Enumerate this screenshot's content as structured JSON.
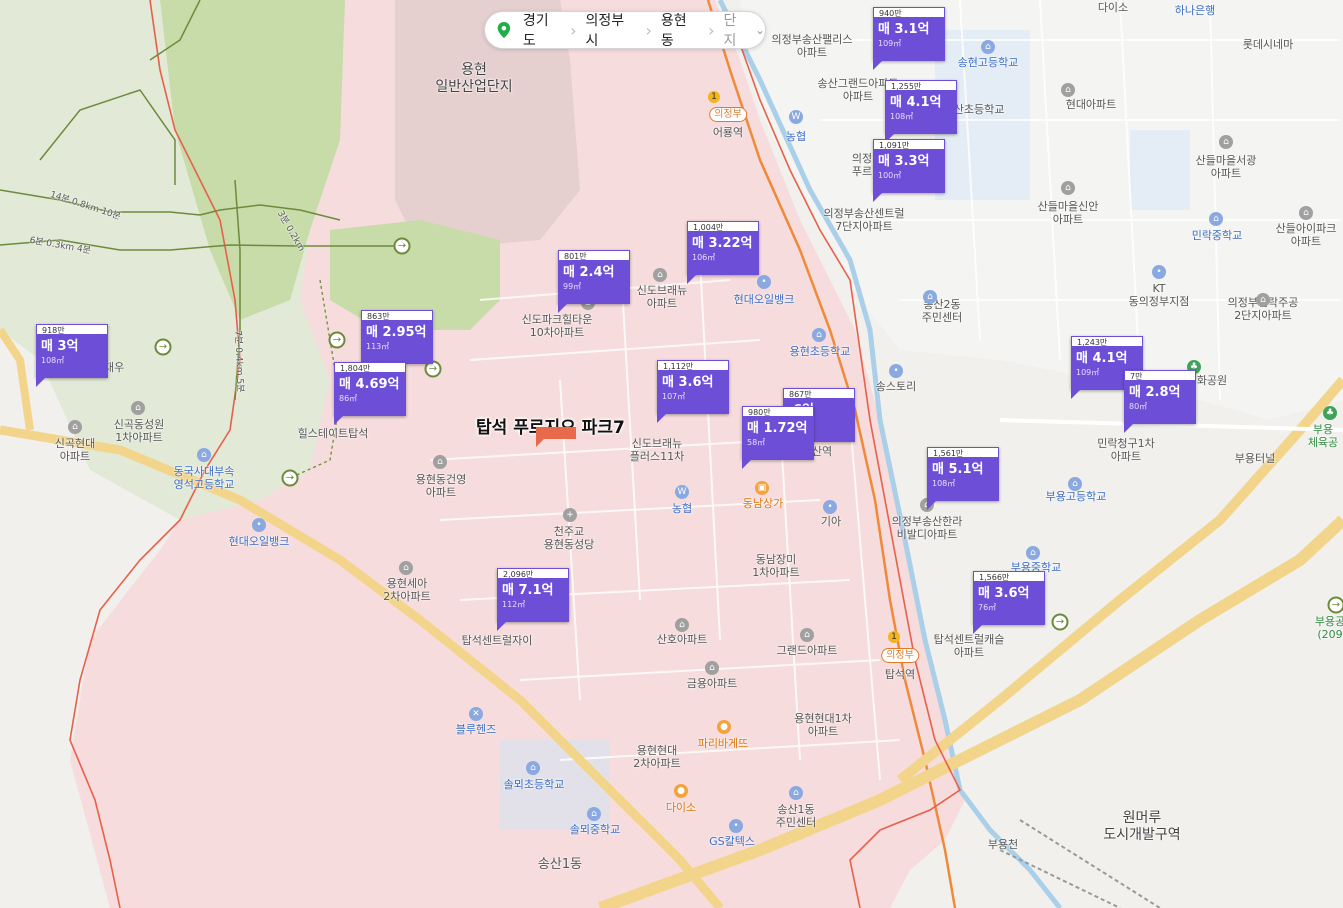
{
  "breadcrumb": {
    "items": [
      "경기도",
      "의정부시",
      "용현동"
    ],
    "dropdown": "단지"
  },
  "selected_complex": "탑석 푸르지오 파크7",
  "listings": [
    {
      "ppa": "940만",
      "price": "매 3.1억",
      "area": "109㎡"
    },
    {
      "ppa": "1,255만",
      "price": "매 4.1억",
      "area": "108㎡"
    },
    {
      "ppa": "1,091만",
      "price": "매 3.3억",
      "area": "100㎡"
    },
    {
      "ppa": "1,004만",
      "price": "매 3.22억",
      "area": "106㎡"
    },
    {
      "ppa": "801만",
      "price": "매 2.4억",
      "area": "99㎡"
    },
    {
      "ppa": "863만",
      "price": "매 2.95억",
      "area": "113㎡"
    },
    {
      "ppa": "918만",
      "price": "매 3억",
      "area": "108㎡"
    },
    {
      "ppa": "1,804만",
      "price": "매 4.69억",
      "area": "86㎡"
    },
    {
      "ppa": "1,112만",
      "price": "매 3.6억",
      "area": "107㎡"
    },
    {
      "ppa": "867만",
      "price": ".6억",
      "area": ""
    },
    {
      "ppa": "980만",
      "price": "매 1.72억",
      "area": "58㎡"
    },
    {
      "ppa": "1,243만",
      "price": "매 4.1억",
      "area": "109㎡"
    },
    {
      "ppa": "7만",
      "price": "매 2.8억",
      "area": "80㎡"
    },
    {
      "ppa": "1,561만",
      "price": "매 5.1억",
      "area": "108㎡"
    },
    {
      "ppa": "2,096만",
      "price": "매 7.1억",
      "area": "112㎡"
    },
    {
      "ppa": "1,566만",
      "price": "매 3.6억",
      "area": "76㎡"
    }
  ],
  "labels": {
    "l0": "용현\n일반산업단지",
    "l1": "의정부송산팰리스\n아파트",
    "l2": "송산그랜드아파트\n아파트",
    "l3": "송산초등학교",
    "l4": "의정\n푸르",
    "l5": "의정부송산센트럴\n7단지아파트",
    "l6": "송현고등학교",
    "l7": "현대아파트",
    "l8": "산들마을서광\n아파트",
    "l9": "산들마을신안\n아파트",
    "l10": "민락중학교",
    "l11": "산들아이파크\n아파트",
    "l12": "다이소",
    "l13": "하나은행",
    "l14": "롯데시네마",
    "l15": "어룡역",
    "l16": "농협",
    "l17": "KT\n동의정부지점",
    "l18": "의정부민락주공\n2단지아파트",
    "l19": "송산2동\n주민센터",
    "l20": "신도브래뉴\n아파트",
    "l21": "현대오일뱅크",
    "l22": "신도파크힐타운\n10차아파트",
    "l23": "용현초등학교",
    "l24": "송스토리",
    "l25": "신도브래뉴\n플러스11차",
    "l26": "송산역",
    "l27": "민락청구1차\n아파트",
    "l28": "화공원",
    "l29": "부용고등학교",
    "l30": "신곡동성원\n1차아파트",
    "l31": "신곡대우",
    "l32": "신곡현대\n아파트",
    "l33": "힐스테이트탑석",
    "l34": "용현동건영\n아파트",
    "l35": "동국사대부속\n영석고등학교",
    "l36": "현대오일뱅크",
    "l37": "천주교\n용현동성당",
    "l38": "농협",
    "l39": "동남상가",
    "l40": "기아",
    "l41": "의정부송산한라\n비발디아파트",
    "l42": "부용중학교",
    "l43": "부용터널",
    "l44": "부용\n체육공",
    "l45": "동남장미\n1차아파트",
    "l46": "용현세아\n2차아파트",
    "l47": "탑석센트럴자이",
    "l48": "산호아파트",
    "l49": "그랜드아파트",
    "l50": "탑석센트럴캐슬\n아파트",
    "l51": "탑석역",
    "l52": "금용아파트",
    "l53": "용현현대1차\n아파트",
    "l54": "블루헨즈",
    "l55": "파리바게뜨",
    "l56": "용현현대\n2차아파트",
    "l57": "솔뫼초등학교",
    "l58": "다이소",
    "l59": "송산1동\n주민센터",
    "l60": "솔뫼중학교",
    "l61": "GS칼텍스",
    "l62": "송산1동",
    "l63": "원머루\n도시개발구역",
    "l64": "부용천",
    "l65": "부용공\n(209",
    "l66": "의정부"
  },
  "trail_labels": [
    "14분 0.8km 10분",
    "6분 0.3km 4분",
    "7분 0.4km 5분",
    "3분 0.2km"
  ],
  "colors": {
    "listing_card": "#6c4fd6",
    "district_fill": "#f6dcdc",
    "boundary": "#e8604a",
    "forest": "#c7dca8",
    "road_major": "#f2d58a",
    "rail": "#f08a3a"
  }
}
